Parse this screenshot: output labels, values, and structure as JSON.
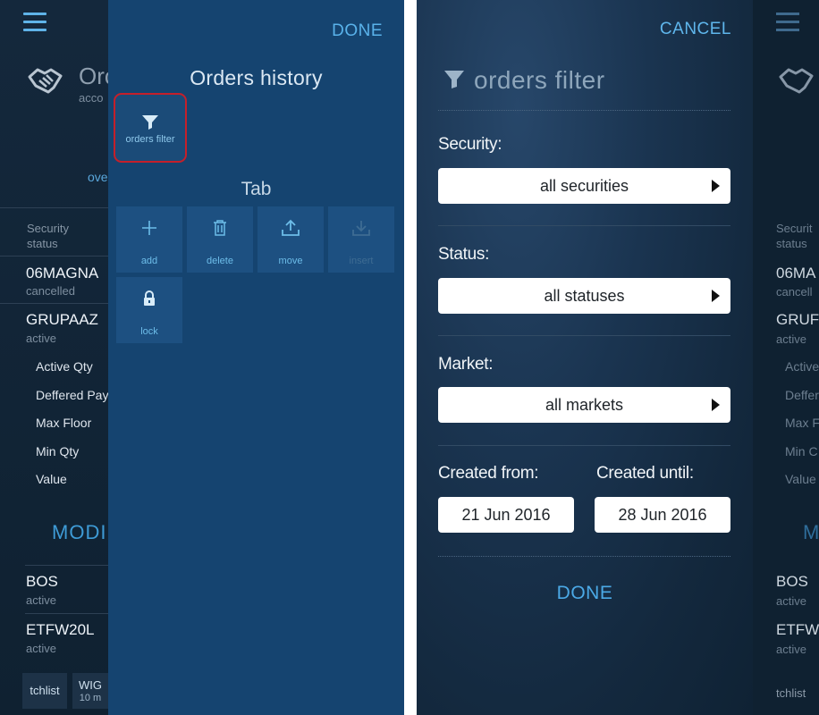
{
  "left_screen": {
    "background": {
      "title_partial": "Orc",
      "subtitle_partial": "acco",
      "overview_partial": "ove",
      "header_col": [
        "Security",
        "status"
      ],
      "rows": [
        {
          "name": "06MAGNA",
          "status": "cancelled"
        },
        {
          "name": "GRUPAAZ",
          "status": "active"
        }
      ],
      "details": [
        "Active Qty",
        "Deffered Pay",
        "Max Floor",
        "Min Qty",
        "Value"
      ],
      "modify_partial": "MODI",
      "rows2": [
        {
          "name": "BOS",
          "status": "active"
        },
        {
          "name": "ETFW20L",
          "status": "active"
        }
      ],
      "bottom_tabs": [
        {
          "label": "tchlist",
          "sub": ""
        },
        {
          "label": "WIG",
          "sub": "10 m"
        }
      ]
    },
    "panel": {
      "done_label": "DONE",
      "title": "Orders history",
      "filter_button_label": "orders filter",
      "tab_section_title": "Tab",
      "tiles": [
        {
          "label": "add",
          "icon": "plus-icon",
          "enabled": true
        },
        {
          "label": "delete",
          "icon": "trash-icon",
          "enabled": true
        },
        {
          "label": "move",
          "icon": "upload-icon",
          "enabled": true
        },
        {
          "label": "insert",
          "icon": "download-icon",
          "enabled": false
        },
        {
          "label": "lock",
          "icon": "lock-icon",
          "enabled": true
        }
      ],
      "colors": {
        "panel": "#154470",
        "tile": "#1d5081",
        "accent": "#59b2ea",
        "highlight": "#c51f2a"
      }
    }
  },
  "right_screen": {
    "cancel_label": "CANCEL",
    "title": "orders filter",
    "security_label": "Security:",
    "security_value": "all securities",
    "status_label": "Status:",
    "status_value": "all statuses",
    "market_label": "Market:",
    "market_value": "all markets",
    "created_from_label": "Created from:",
    "created_from_value": "21 Jun 2016",
    "created_until_label": "Created until:",
    "created_until_value": "28 Jun 2016",
    "done_label": "DONE",
    "background_strip": {
      "header_col": [
        "Securit",
        "status"
      ],
      "rows": [
        {
          "name": "06MA",
          "status": "cancell"
        },
        {
          "name": "GRUF",
          "status": "active"
        }
      ],
      "details": [
        "Active",
        "Deffer",
        "Max F",
        "Min C",
        "Value"
      ],
      "modify_partial": "M",
      "rows2": [
        {
          "name": "BOS",
          "status": "active"
        },
        {
          "name": "ETFW",
          "status": "active"
        }
      ],
      "bottom_tab": "tchlist"
    }
  }
}
